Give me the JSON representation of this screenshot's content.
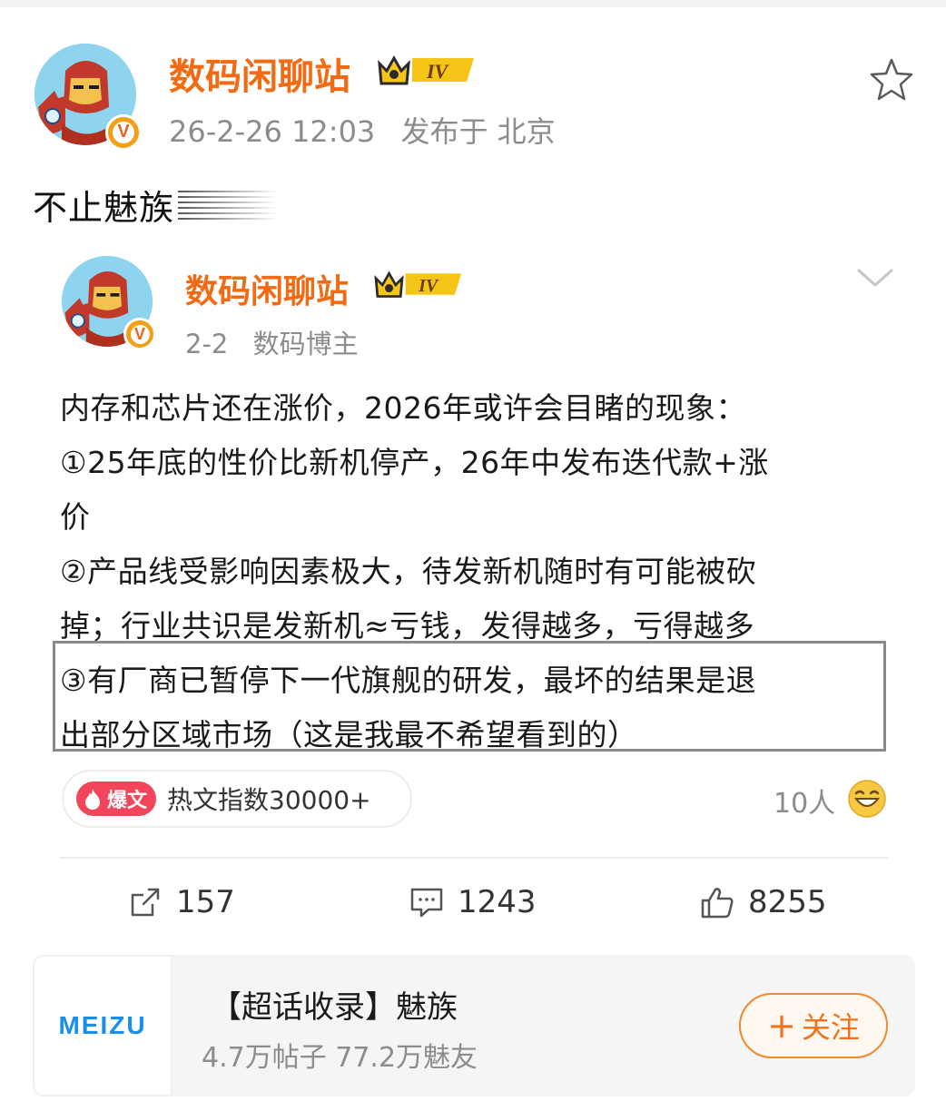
{
  "post": {
    "author": "数码闲聊站",
    "level": "IV",
    "timestamp": "26-2-26 12:03",
    "location": "发布于 北京",
    "text": "不止魅族"
  },
  "repost": {
    "author": "数码闲聊站",
    "level": "IV",
    "date": "2-2",
    "source": "数码博主",
    "lines": [
      "内存和芯片还在涨价，2026年或许会目睹的现象：",
      "①25年底的性价比新机停产，26年中发布迭代款+涨",
      "价",
      "②产品线受影响因素极大，待发新机随时有可能被砍",
      "掉；行业共识是发新机≈亏钱，发得越多，亏得越多",
      "③有厂商已暂停下一代旗舰的研发，最坏的结果是退",
      "出部分区域市场（这是我最不希望看到的）"
    ],
    "hot_tag": "爆文",
    "hot_text": "热文指数30000+",
    "reactions": "10人"
  },
  "actions": {
    "repost_count": "157",
    "comment_count": "1243",
    "like_count": "8255"
  },
  "topic": {
    "logo_text": "MEIZU",
    "title": "【超话收录】魅族",
    "stats": "4.7万帖子 77.2万魅友",
    "follow_label": "关注",
    "follow_plus": "+"
  },
  "colors": {
    "username": "#f26a12",
    "meta": "#8c8c8c",
    "hot_tag": "#f2455b",
    "follow": "#f0711a",
    "logo": "#1a8fe8"
  }
}
